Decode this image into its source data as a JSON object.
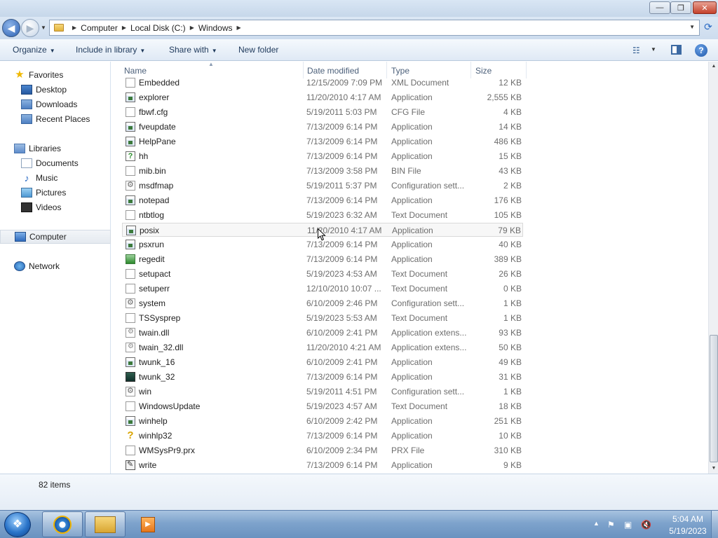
{
  "window": {
    "minimize_label": "—",
    "maximize_label": "❐",
    "close_label": "✕"
  },
  "address": {
    "crumbs": [
      "Computer",
      "Local Disk (C:)",
      "Windows"
    ]
  },
  "toolbar": {
    "organize": "Organize",
    "include": "Include in library",
    "share": "Share with",
    "new_folder": "New folder",
    "help": "?"
  },
  "nav": {
    "favorites": "Favorites",
    "desktop": "Desktop",
    "downloads": "Downloads",
    "recent": "Recent Places",
    "libraries": "Libraries",
    "documents": "Documents",
    "music": "Music",
    "pictures": "Pictures",
    "videos": "Videos",
    "computer": "Computer",
    "network": "Network"
  },
  "columns": {
    "name": "Name",
    "date": "Date modified",
    "type": "Type",
    "size": "Size"
  },
  "files": [
    {
      "name": "Embedded",
      "date": "12/15/2009 7:09 PM",
      "type": "XML Document",
      "size": "12 KB",
      "icon": "document-icon"
    },
    {
      "name": "explorer",
      "date": "11/20/2010 4:17 AM",
      "type": "Application",
      "size": "2,555 KB",
      "icon": "application-icon"
    },
    {
      "name": "fbwf.cfg",
      "date": "5/19/2011 5:03 PM",
      "type": "CFG File",
      "size": "4 KB",
      "icon": "document-icon"
    },
    {
      "name": "fveupdate",
      "date": "7/13/2009 6:14 PM",
      "type": "Application",
      "size": "14 KB",
      "icon": "application-icon"
    },
    {
      "name": "HelpPane",
      "date": "7/13/2009 6:14 PM",
      "type": "Application",
      "size": "486 KB",
      "icon": "application-icon"
    },
    {
      "name": "hh",
      "date": "7/13/2009 6:14 PM",
      "type": "Application",
      "size": "15 KB",
      "icon": "help-application-icon"
    },
    {
      "name": "mib.bin",
      "date": "7/13/2009 3:58 PM",
      "type": "BIN File",
      "size": "43 KB",
      "icon": "document-icon"
    },
    {
      "name": "msdfmap",
      "date": "5/19/2011 5:37 PM",
      "type": "Configuration sett...",
      "size": "2 KB",
      "icon": "settings-file-icon"
    },
    {
      "name": "notepad",
      "date": "7/13/2009 6:14 PM",
      "type": "Application",
      "size": "176 KB",
      "icon": "application-icon"
    },
    {
      "name": "ntbtlog",
      "date": "5/19/2023 6:32 AM",
      "type": "Text Document",
      "size": "105 KB",
      "icon": "document-icon"
    },
    {
      "name": "posix",
      "date": "11/20/2010 4:17 AM",
      "type": "Application",
      "size": "79 KB",
      "icon": "application-icon"
    },
    {
      "name": "psxrun",
      "date": "7/13/2009 6:14 PM",
      "type": "Application",
      "size": "40 KB",
      "icon": "application-icon"
    },
    {
      "name": "regedit",
      "date": "7/13/2009 6:14 PM",
      "type": "Application",
      "size": "389 KB",
      "icon": "regedit-icon"
    },
    {
      "name": "setupact",
      "date": "5/19/2023 4:53 AM",
      "type": "Text Document",
      "size": "26 KB",
      "icon": "document-icon"
    },
    {
      "name": "setuperr",
      "date": "12/10/2010 10:07 ...",
      "type": "Text Document",
      "size": "0 KB",
      "icon": "document-icon"
    },
    {
      "name": "system",
      "date": "6/10/2009 2:46 PM",
      "type": "Configuration sett...",
      "size": "1 KB",
      "icon": "settings-file-icon"
    },
    {
      "name": "TSSysprep",
      "date": "5/19/2023 5:53 AM",
      "type": "Text Document",
      "size": "1 KB",
      "icon": "document-icon"
    },
    {
      "name": "twain.dll",
      "date": "6/10/2009 2:41 PM",
      "type": "Application extens...",
      "size": "93 KB",
      "icon": "dll-icon"
    },
    {
      "name": "twain_32.dll",
      "date": "11/20/2010 4:21 AM",
      "type": "Application extens...",
      "size": "50 KB",
      "icon": "dll-icon"
    },
    {
      "name": "twunk_16",
      "date": "6/10/2009 2:41 PM",
      "type": "Application",
      "size": "49 KB",
      "icon": "application-icon"
    },
    {
      "name": "twunk_32",
      "date": "7/13/2009 6:14 PM",
      "type": "Application",
      "size": "31 KB",
      "icon": "scanner-icon"
    },
    {
      "name": "win",
      "date": "5/19/2011 4:51 PM",
      "type": "Configuration sett...",
      "size": "1 KB",
      "icon": "settings-file-icon"
    },
    {
      "name": "WindowsUpdate",
      "date": "5/19/2023 4:57 AM",
      "type": "Text Document",
      "size": "18 KB",
      "icon": "document-icon"
    },
    {
      "name": "winhelp",
      "date": "6/10/2009 2:42 PM",
      "type": "Application",
      "size": "251 KB",
      "icon": "application-icon"
    },
    {
      "name": "winhlp32",
      "date": "7/13/2009 6:14 PM",
      "type": "Application",
      "size": "10 KB",
      "icon": "question-mark-icon"
    },
    {
      "name": "WMSysPr9.prx",
      "date": "6/10/2009 2:34 PM",
      "type": "PRX File",
      "size": "310 KB",
      "icon": "document-icon"
    },
    {
      "name": "write",
      "date": "7/13/2009 6:14 PM",
      "type": "Application",
      "size": "9 KB",
      "icon": "write-icon"
    }
  ],
  "status": {
    "item_count": "82 items"
  },
  "taskbar": {
    "time": "5:04 AM",
    "date": "5/19/2023"
  }
}
